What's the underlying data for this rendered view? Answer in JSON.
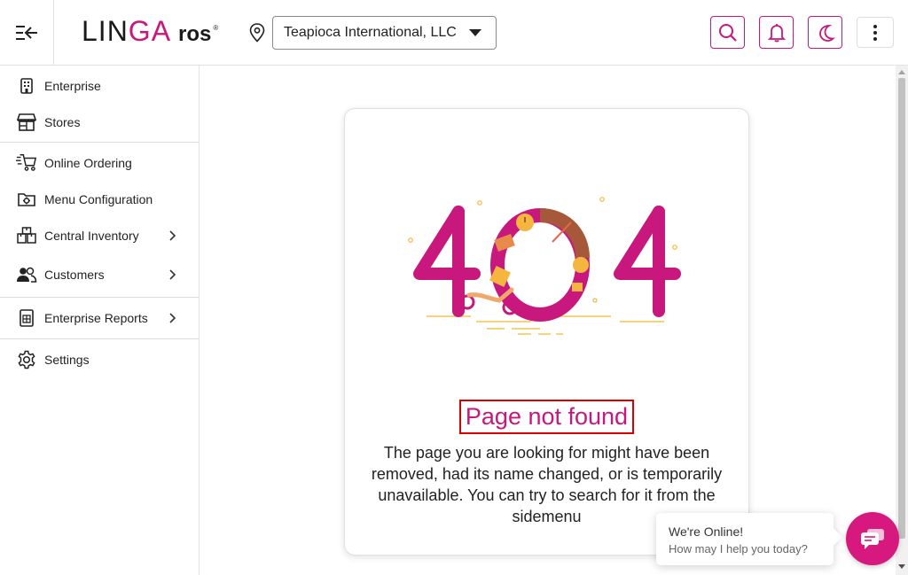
{
  "header": {
    "brand_main_prefix": "LIN",
    "brand_main_accent": "GA",
    "brand_sub": "ros",
    "brand_reg": "®",
    "store_selected": "Teapioca International, LLC",
    "icons": [
      "menu-collapse-icon",
      "location-pin-icon",
      "search-icon",
      "bell-icon",
      "moon-icon",
      "more-vertical-icon"
    ]
  },
  "sidebar": {
    "items": [
      {
        "label": "Enterprise",
        "icon": "building-icon",
        "has_chevron": false
      },
      {
        "label": "Stores",
        "icon": "store-icon",
        "has_chevron": false
      },
      {
        "label": "Online Ordering",
        "icon": "cart-icon",
        "has_chevron": false
      },
      {
        "label": "Menu Configuration",
        "icon": "folder-gear-icon",
        "has_chevron": false
      },
      {
        "label": "Central Inventory",
        "icon": "inventory-icon",
        "has_chevron": true
      },
      {
        "label": "Customers",
        "icon": "customers-icon",
        "has_chevron": true
      },
      {
        "label": "Enterprise Reports",
        "icon": "report-icon",
        "has_chevron": true
      },
      {
        "label": "Settings",
        "icon": "settings-icon",
        "has_chevron": false
      }
    ]
  },
  "main": {
    "title": "Page not found",
    "description": "The page you are looking for might have been removed, had its name changed, or is temporarily unavailable. You can try to search for it from the sidemenu"
  },
  "chat": {
    "status": "We're Online!",
    "prompt": "How may I help you today?"
  },
  "colors": {
    "brand": "#c8177d",
    "illustration_accent": "#f4b63f",
    "highlight_border": "#d60000"
  }
}
